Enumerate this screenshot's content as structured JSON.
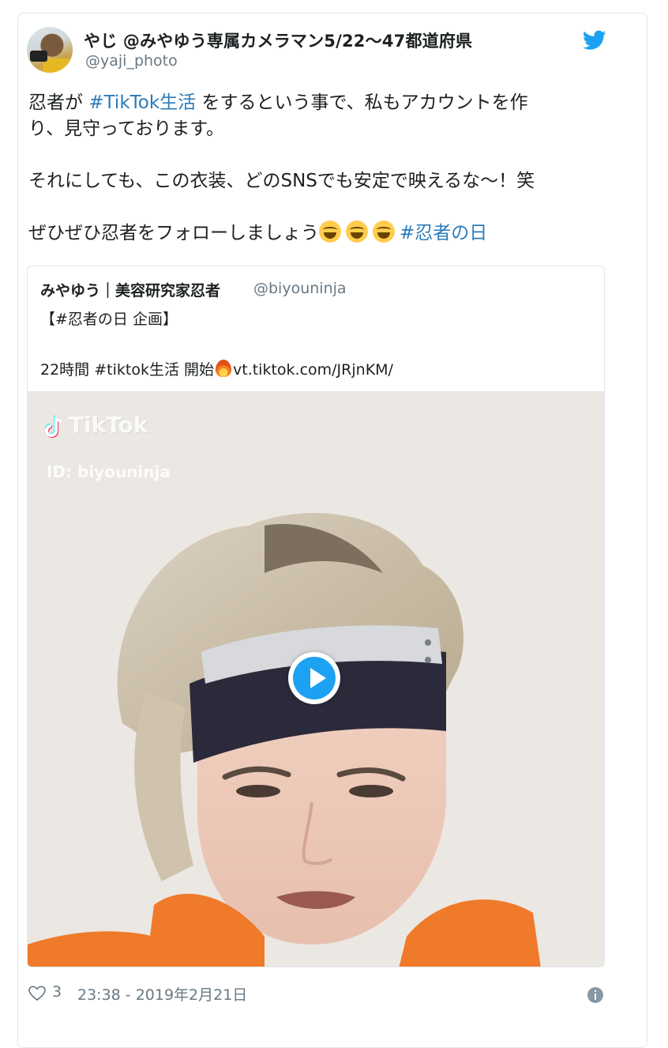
{
  "author": {
    "display_name": "やじ @みやゆう専属カメラマン5/22〜47都道府県",
    "screen_name": "@yaji_photo"
  },
  "tweet": {
    "line1_pre": "忍者が",
    "line1_tag": "#TikTok生活",
    "line1_post": "をするという事で、私もアカウントを作",
    "line2": "り、見守っております。",
    "line3": "それにしても、この衣装、どのSNSでも安定で映えるな〜！笑",
    "line4_pre": "ぜひぜひ忍者をフォローしましょう",
    "line4_tag": "#忍者の日",
    "emoji": "grinning-squinting-face"
  },
  "quoted": {
    "name": "みやゆう｜美容研究家忍者",
    "handle": "@biyouninja",
    "line1": "【#忍者の日 企画】",
    "line2_pre": "22時間 #tiktok生活 開始",
    "line2_link": "vt.tiktok.com/JRjnKM/"
  },
  "media": {
    "watermark_logo": "TikTok",
    "watermark_id": "ID: biyouninja"
  },
  "footer": {
    "like_count": "3",
    "timestamp": "23:38 - 2019年2月21日"
  },
  "colors": {
    "link": "#2b7bb9",
    "twitter_blue": "#1da1f2",
    "muted": "#697882"
  }
}
